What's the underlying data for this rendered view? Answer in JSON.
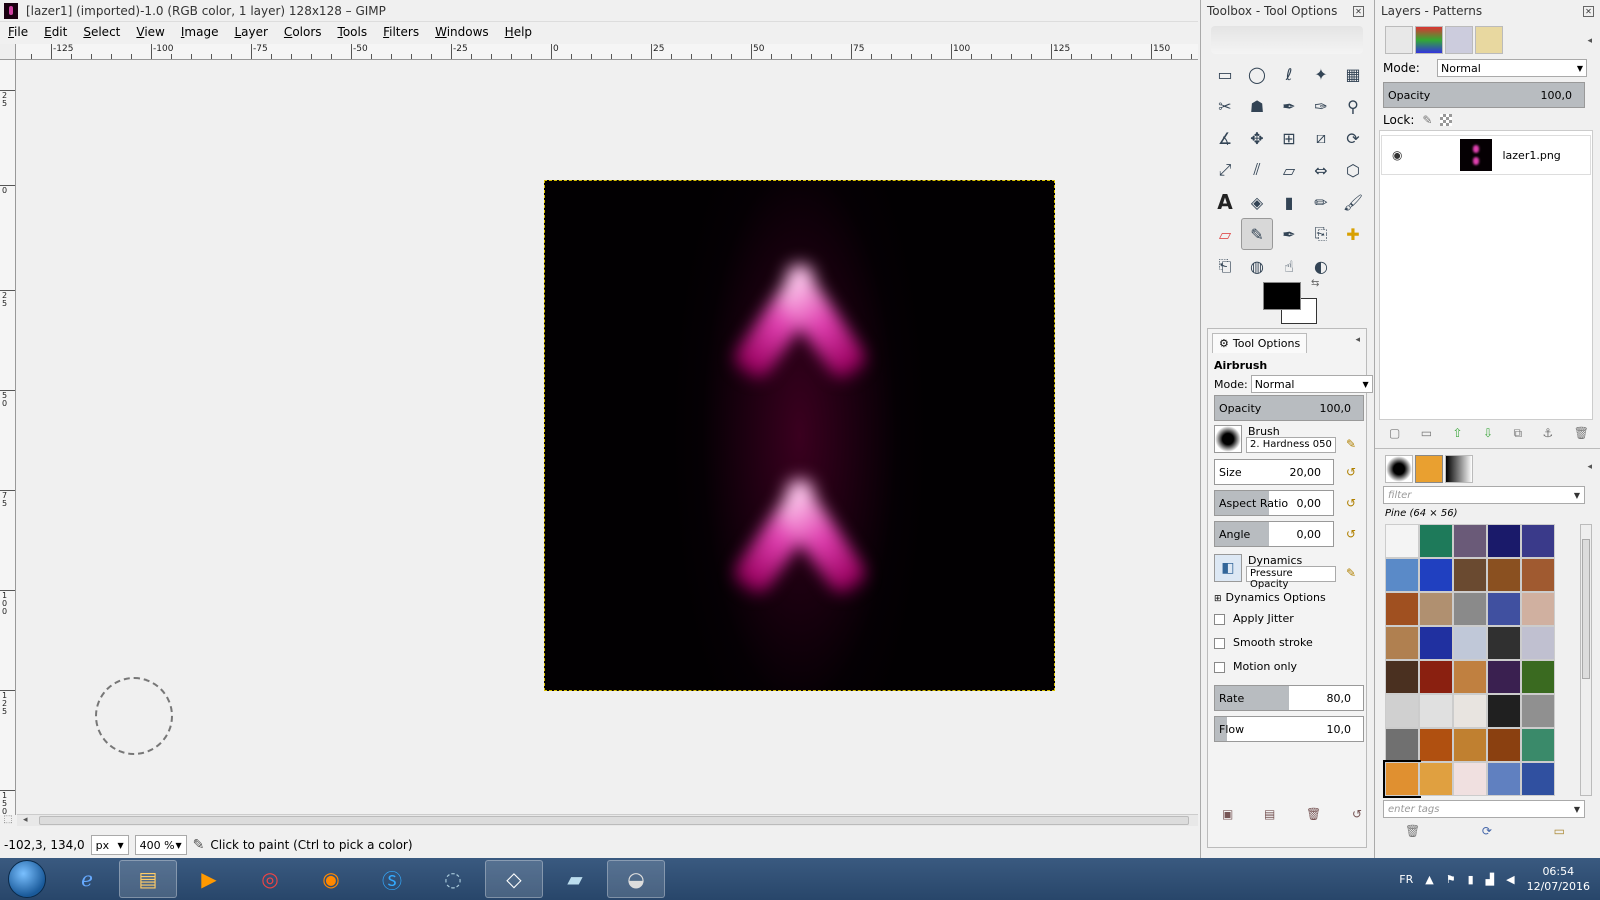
{
  "window": {
    "title": "[lazer1] (imported)-1.0 (RGB color, 1 layer) 128x128 – GIMP"
  },
  "menu": [
    "File",
    "Edit",
    "Select",
    "View",
    "Image",
    "Layer",
    "Colors",
    "Tools",
    "Filters",
    "Windows",
    "Help"
  ],
  "ruler": {
    "h_labels": [
      "-125",
      "-100",
      "-75",
      "-50",
      "-25",
      "0",
      "25",
      "50",
      "75",
      "100",
      "125",
      "150"
    ],
    "v_labels": [
      "25",
      "0",
      "25",
      "50",
      "75",
      "100",
      "125",
      "150"
    ]
  },
  "status": {
    "coords": "-102,3, 134,0",
    "unit": "px",
    "zoom": "400 %",
    "message": "Click to paint (Ctrl to pick a color)"
  },
  "toolbox": {
    "title": "Toolbox - Tool Options",
    "tools": [
      "rect-select",
      "ellipse-select",
      "lasso",
      "fuzzy-select",
      "color-select",
      "scissors",
      "foreground-select",
      "paths",
      "color-picker",
      "zoom",
      "measure",
      "move",
      "align",
      "crop",
      "rotate",
      "scale",
      "shear",
      "perspective",
      "flip",
      "cage",
      "text",
      "bucket-fill",
      "blend",
      "pencil",
      "paintbrush",
      "eraser",
      "airbrush",
      "ink",
      "clone",
      "heal",
      "perspective-clone",
      "blur",
      "smudge",
      "dodge-burn"
    ],
    "active_tool": "airbrush"
  },
  "tool_options": {
    "tab_label": "Tool Options",
    "tool_name": "Airbrush",
    "mode_label": "Mode:",
    "mode_value": "Normal",
    "opacity_label": "Opacity",
    "opacity_value": "100,0",
    "opacity_fraction": 1.0,
    "brush_label": "Brush",
    "brush_value": "2. Hardness 050",
    "size_label": "Size",
    "size_value": "20,00",
    "aspect_label": "Aspect Ratio",
    "aspect_value": "0,00",
    "angle_label": "Angle",
    "angle_value": "0,00",
    "dynamics_label": "Dynamics",
    "dynamics_value": "Pressure Opacity",
    "dynamics_options": "Dynamics Options",
    "apply_jitter": "Apply Jitter",
    "smooth_stroke": "Smooth stroke",
    "motion_only": "Motion only",
    "rate_label": "Rate",
    "rate_value": "80,0",
    "rate_fraction": 0.5,
    "flow_label": "Flow",
    "flow_value": "10,0",
    "flow_fraction": 0.08
  },
  "layers": {
    "title": "Layers - Patterns",
    "mode_label": "Mode:",
    "mode_value": "Normal",
    "opacity_label": "Opacity",
    "opacity_value": "100,0",
    "lock_label": "Lock:",
    "layer_name": "lazer1.png"
  },
  "patterns": {
    "filter_placeholder": "filter",
    "selected": "Pine (64 × 56)",
    "tags_placeholder": "enter tags",
    "colors": [
      "#f4f4f4",
      "#1e7a5a",
      "#6a5a78",
      "#1a1a6a",
      "#3a3a8a",
      "#5a8ac8",
      "#2040c0",
      "#6a4a30",
      "#8a5020",
      "#a05a30",
      "#a05020",
      "#b09070",
      "#8a8a8a",
      "#4050a0",
      "#d0b0a0",
      "#b08050",
      "#2030a0",
      "#c0c8d8",
      "#303030",
      "#c0c0d0",
      "#4a3020",
      "#8a2010",
      "#c08040",
      "#3a2050",
      "#3a6a20",
      "#d0d0d0",
      "#e0e0e0",
      "#e8e4e0",
      "#202020",
      "#909090",
      "#707070",
      "#b05010",
      "#c08030",
      "#8a4010",
      "#3a8a6a",
      "#e09030",
      "#e0a040",
      "#f0e0e0",
      "#6080c0",
      "#3050a0"
    ]
  },
  "taskbar": {
    "apps": [
      "ie",
      "explorer",
      "media",
      "chrome",
      "firefox",
      "skype",
      "app7",
      "unity",
      "app9",
      "gimp"
    ],
    "lang": "FR",
    "time": "06:54",
    "date": "12/07/2016"
  }
}
